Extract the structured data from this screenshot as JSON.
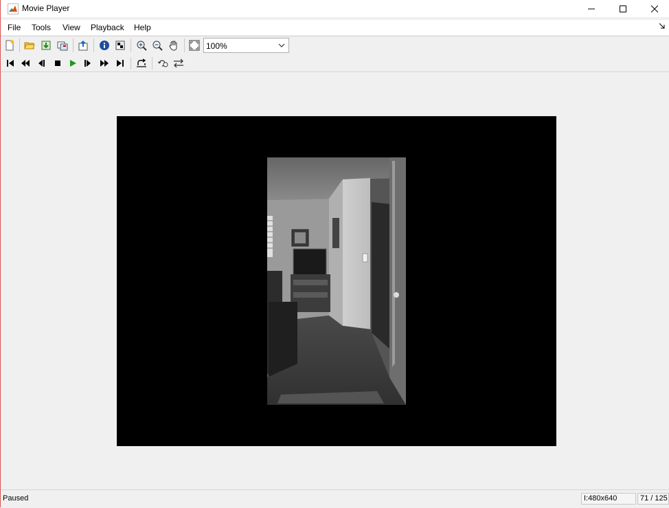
{
  "window": {
    "title": "Movie Player"
  },
  "menu": {
    "items": [
      "File",
      "Tools",
      "View",
      "Playback",
      "Help"
    ]
  },
  "toolbar": {
    "zoom_value": "100%",
    "icons": [
      "new-file-icon",
      "open-folder-icon",
      "import-icon",
      "export-icon",
      "save-to-workspace-icon",
      "info-icon",
      "colormap-icon",
      "zoom-in-icon",
      "zoom-out-icon",
      "pan-hand-icon",
      "fit-to-window-icon"
    ]
  },
  "playback": {
    "icons": [
      "go-to-first-icon",
      "rewind-icon",
      "step-back-icon",
      "stop-icon",
      "play-icon",
      "step-forward-icon",
      "fast-forward-icon",
      "go-to-last-icon",
      "loop-icon",
      "playback-rate-icon",
      "toggle-direction-icon"
    ],
    "play_color": "#1a9a1a"
  },
  "status": {
    "text": "Paused",
    "resolution": "I:480x640",
    "frame": "71 / 125"
  }
}
